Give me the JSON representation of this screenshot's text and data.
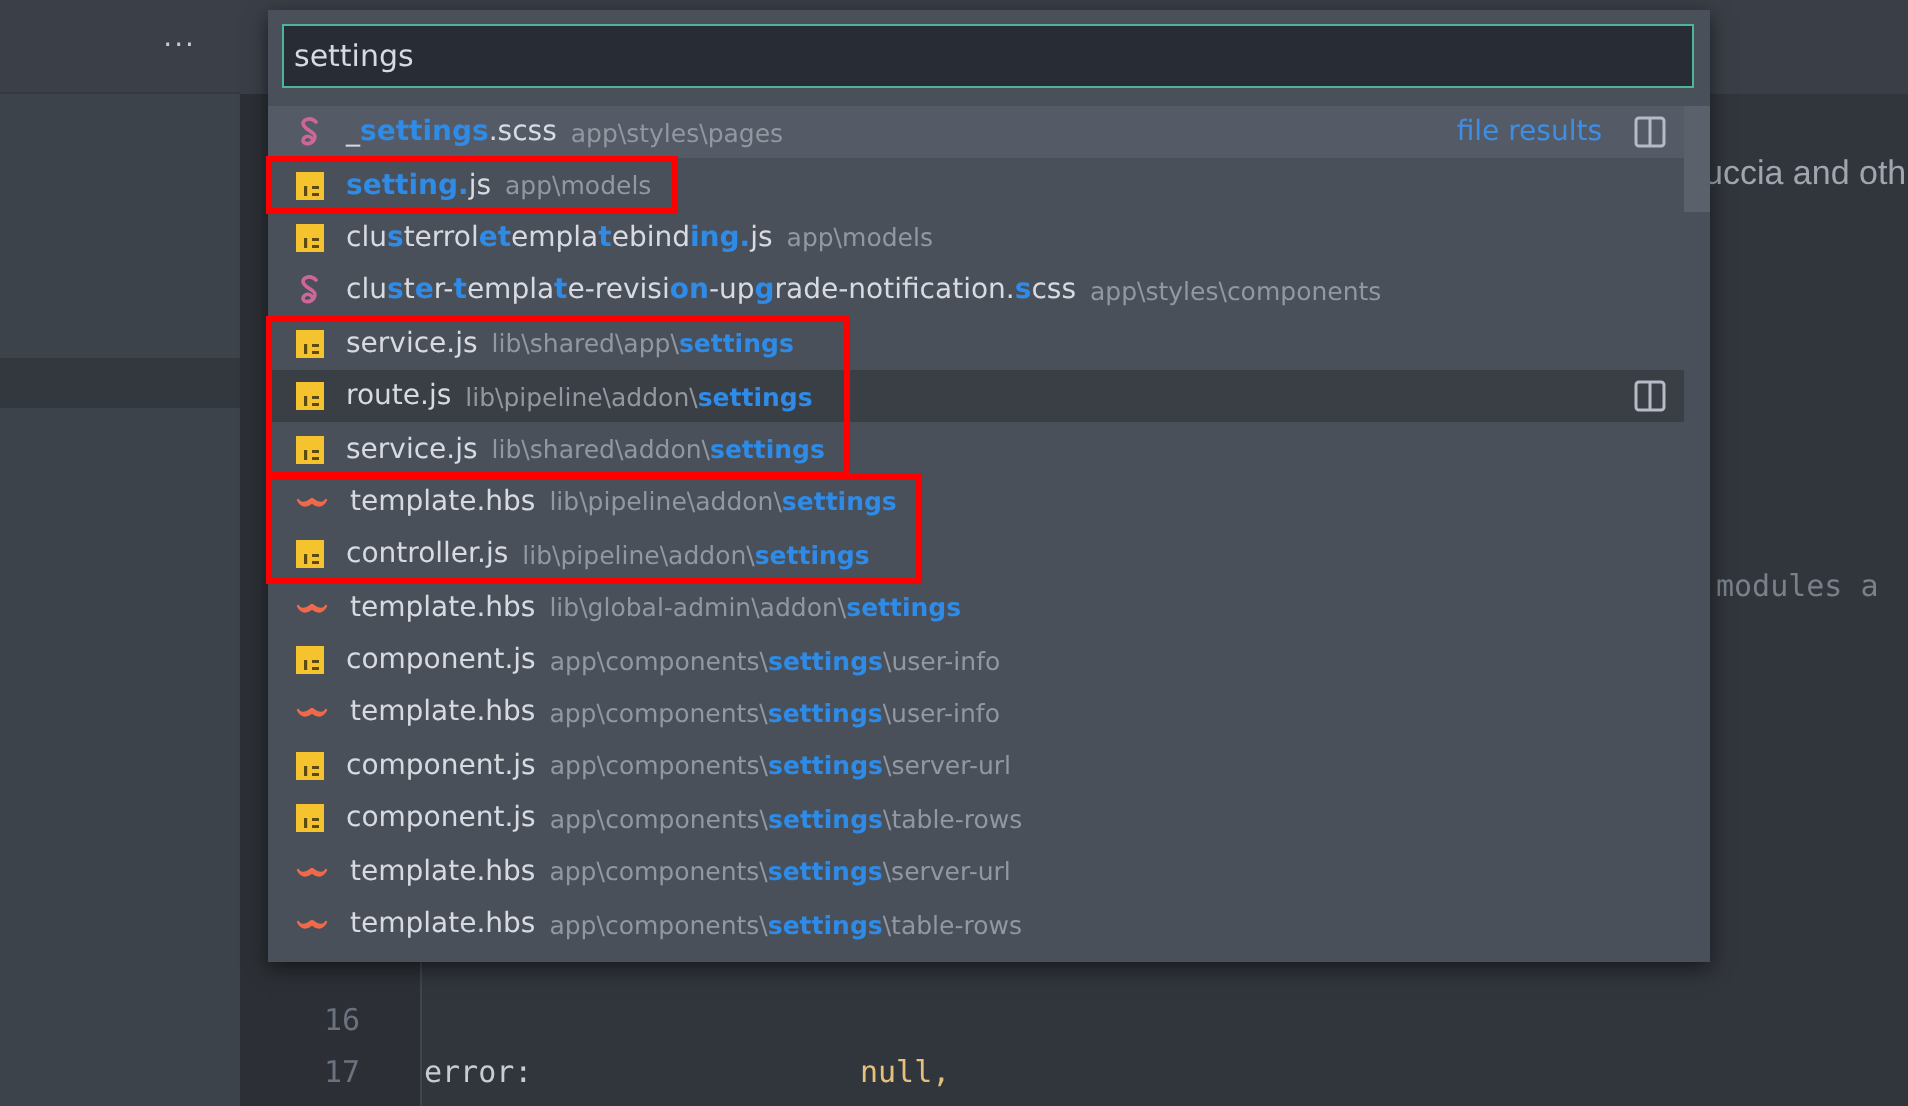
{
  "sidebar": {
    "menu": "···"
  },
  "editor": {
    "fragments": [
      "uccia and oth",
      "modules a"
    ],
    "lines": [
      {
        "number": "16"
      },
      {
        "number": "17",
        "key": "error:",
        "value": "null,",
        "kind": "literal"
      }
    ]
  },
  "palette": {
    "query": "settings",
    "results": [
      {
        "kind": "scss",
        "name": "_**settings**.scss",
        "path": "app\\styles\\pages",
        "selected": true,
        "hovered": false,
        "framed": false,
        "hint": "file results"
      },
      {
        "kind": "js",
        "name": "**setting.**js",
        "path": "app\\models",
        "selected": false,
        "hovered": false,
        "framed": true,
        "frame_start": true
      },
      {
        "kind": "js",
        "name": "clu**s**terrol**et**empla**t**ebind**ing.**js",
        "path": "app\\models",
        "selected": false,
        "hovered": false,
        "framed": false
      },
      {
        "kind": "scss",
        "name": "clu**s**t**e**r-**t**empla**t**e-revisi**on**-up**g**rade-notification.**s**css",
        "path": "app\\styles\\components",
        "selected": false,
        "hovered": false,
        "framed": false
      },
      {
        "kind": "js",
        "name": "service.js",
        "path": "lib\\shared\\app\\**settings**",
        "selected": false,
        "hovered": false,
        "framed": true,
        "frame_start": true
      },
      {
        "kind": "js",
        "name": "route.js",
        "path": "lib\\pipeline\\addon\\**settings**",
        "selected": false,
        "hovered": true,
        "framed": true,
        "frame_start": false
      },
      {
        "kind": "js",
        "name": "service.js",
        "path": "lib\\shared\\addon\\**settings**",
        "selected": false,
        "hovered": false,
        "framed": true,
        "frame_start": false
      },
      {
        "kind": "hbs",
        "name": "template.hbs",
        "path": "lib\\pipeline\\addon\\**settings**",
        "selected": false,
        "hovered": false,
        "framed": true,
        "frame_start": true
      },
      {
        "kind": "js",
        "name": "controller.js",
        "path": "lib\\pipeline\\addon\\**settings**",
        "selected": false,
        "hovered": false,
        "framed": true,
        "frame_start": false
      },
      {
        "kind": "hbs",
        "name": "template.hbs",
        "path": "lib\\global-admin\\addon\\**settings**",
        "selected": false,
        "hovered": false,
        "framed": false
      },
      {
        "kind": "js",
        "name": "component.js",
        "path": "app\\components\\**settings**\\user-info",
        "selected": false,
        "hovered": false,
        "framed": false
      },
      {
        "kind": "hbs",
        "name": "template.hbs",
        "path": "app\\components\\**settings**\\user-info",
        "selected": false,
        "hovered": false,
        "framed": false
      },
      {
        "kind": "js",
        "name": "component.js",
        "path": "app\\components\\**settings**\\server-url",
        "selected": false,
        "hovered": false,
        "framed": false
      },
      {
        "kind": "js",
        "name": "component.js",
        "path": "app\\components\\**settings**\\table-rows",
        "selected": false,
        "hovered": false,
        "framed": false
      },
      {
        "kind": "hbs",
        "name": "template.hbs",
        "path": "app\\components\\**settings**\\server-url",
        "selected": false,
        "hovered": false,
        "framed": false
      },
      {
        "kind": "hbs",
        "name": "template.hbs",
        "path": "app\\components\\**settings**\\table-rows",
        "selected": false,
        "hovered": false,
        "framed": false
      }
    ]
  }
}
